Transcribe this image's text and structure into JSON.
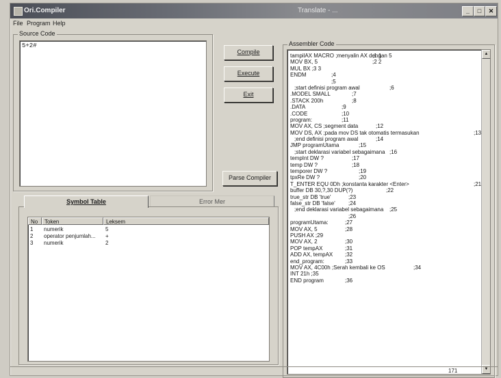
{
  "window": {
    "title": "Ori.Compiler",
    "center_title": "Translate - ...",
    "minimize_label": "_",
    "maximize_label": "□",
    "close_label": "✕",
    "icon": "app-icon"
  },
  "menu": {
    "file": "File",
    "program": "Program",
    "help": "Help"
  },
  "source": {
    "label": "Source Code",
    "text": "5+2#"
  },
  "buttons": {
    "compile": "Compile",
    "execute": "Execute",
    "exit": "Exit",
    "parse": "Parse Compiler"
  },
  "tabs": {
    "symbol_table": "Symbol Table",
    "error": "Error Mer"
  },
  "symbol_table": {
    "columns": [
      "No",
      "Token",
      "Leksem"
    ],
    "rows": [
      {
        "no": "1",
        "token": "numerik",
        "leksem": "5"
      },
      {
        "no": "2",
        "token": "operator penjumlah...",
        "leksem": "+"
      },
      {
        "no": "3",
        "token": "numerik",
        "leksem": "2"
      }
    ]
  },
  "assembler": {
    "label": "Assembler Code",
    "lines": [
      {
        "text": "tampilAX MACRO ;menyalin AX dengan 5",
        "no": ";1 1"
      },
      {
        "text": "MOV BX, 5",
        "no": ";2 2"
      },
      {
        "text": "MUL BX ;3 3",
        "no": ""
      },
      {
        "text": "ENDM",
        "no": ";4"
      },
      {
        "text": "",
        "no": ";5"
      },
      {
        "text": ";start definisi program awal",
        "no": ";6"
      },
      {
        "text": ".MODEL SMALL",
        "no": ";7"
      },
      {
        "text": ".STACK 200h",
        "no": ";8"
      },
      {
        "text": ".DATA",
        "no": ";9"
      },
      {
        "text": ".CODE",
        "no": ";10"
      },
      {
        "text": "program:",
        "no": ";11"
      },
      {
        "text": "MOV AX, CS ;segment data",
        "no": ";12"
      },
      {
        "text": "MOV DS, AX ;pada mov DS tak otomatis termasukan",
        "no": ";13"
      },
      {
        "text": ";end definisi program awal",
        "no": ";14"
      },
      {
        "text": "JMP programUtama",
        "no": ";15"
      },
      {
        "text": ";start deklarasi variabel sebagaimana",
        "no": ";16"
      },
      {
        "text": "tempInt DW ?",
        "no": ";17"
      },
      {
        "text": "temp DW ?",
        "no": ";18"
      },
      {
        "text": "temporer DW ?",
        "no": ";19"
      },
      {
        "text": "tpxRe DW ?",
        "no": ";20"
      },
      {
        "text": "T_ENTER EQU 0Dh ;konstanta karakter <Enter>",
        "no": ";21"
      },
      {
        "text": "buffer DB 30,?,30 DUP(?)",
        "no": ";22"
      },
      {
        "text": "true_str DB 'true'",
        "no": ";23"
      },
      {
        "text": "false_str DB 'false'",
        "no": ";24"
      },
      {
        "text": ";end deklarasi variabel sebagaimana",
        "no": ";25"
      },
      {
        "text": "",
        "no": ";26"
      },
      {
        "text": "programUtama:",
        "no": ";27"
      },
      {
        "text": "MOV AX, 5",
        "no": ";28"
      },
      {
        "text": "PUSH AX ;29",
        "no": ""
      },
      {
        "text": "MOV AX, 2",
        "no": ";30"
      },
      {
        "text": "POP tempAX",
        "no": ";31"
      },
      {
        "text": "ADD AX, tempAX",
        "no": ";32"
      },
      {
        "text": "end_program:",
        "no": ";33"
      },
      {
        "text": "MOV AX, 4C00h ;Serah kembali ke OS",
        "no": ";34"
      },
      {
        "text": "INT 21h ;35",
        "no": ""
      },
      {
        "text": "END program",
        "no": ";36"
      }
    ]
  },
  "status": {
    "right": "171"
  }
}
